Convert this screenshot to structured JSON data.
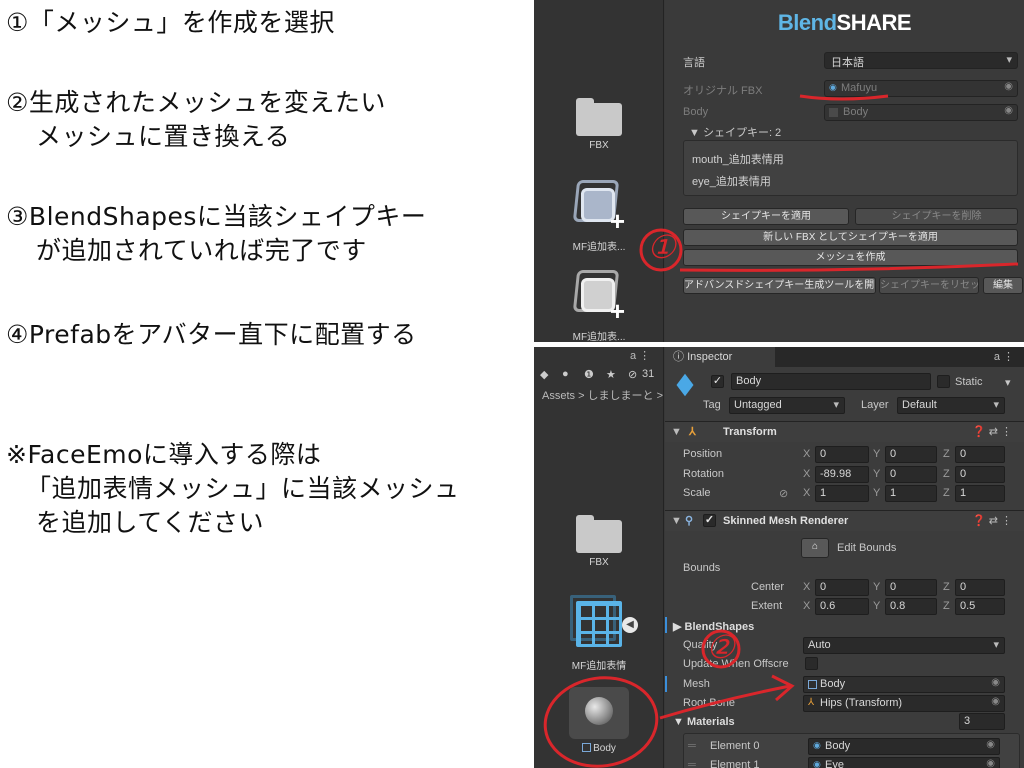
{
  "instructions": {
    "step1": "①「メッシュ」を作成を選択",
    "step2_line1": "②生成されたメッシュを変えたい",
    "step2_line2": "メッシュに置き換える",
    "step3_line1": "③BlendShapesに当該シェイプキー",
    "step3_line2": "が追加されていれば完了です",
    "step4": "④Prefabをアバター直下に配置する",
    "note_line1": "※FaceEmoに導入する際は",
    "note_line2": "「追加表情メッシュ」に当該メッシュ",
    "note_line3": "を追加してください"
  },
  "top_panel": {
    "assets": [
      {
        "name": "FBX",
        "icon": "folder-icon"
      },
      {
        "name": "MF追加表...",
        "icon": "mesh-filter-prefab-icon"
      },
      {
        "name": "MF追加表...",
        "icon": "mesh-filter-prefab-icon"
      }
    ],
    "blendshare": {
      "logo_part1": "Blend",
      "logo_part2": "SHARE",
      "language_label": "言語",
      "language_value": "日本語",
      "original_fbx_label": "オリジナル FBX",
      "original_fbx_value": "Mafuyu",
      "body_label": "Body",
      "body_value": "Body",
      "shapekeys_header": "▼ シェイプキー: 2",
      "shapekeys": [
        "mouth_追加表情用",
        "eye_追加表情用"
      ],
      "btn_apply": "シェイプキーを適用",
      "btn_delete": "シェイプキーを削除",
      "btn_new_fbx": "新しい FBX としてシェイプキーを適用",
      "btn_create_mesh": "メッシュを作成",
      "btn_advanced": "アドバンスドシェイプキー生成ツールを開く",
      "btn_reset": "シェイプキーをリセット",
      "btn_edit": "編集"
    }
  },
  "bottom_panel": {
    "toolbar_count": "31",
    "breadcrumb": "Assets > しましまーと >",
    "assets": [
      {
        "name": "FBX",
        "icon": "folder-icon"
      },
      {
        "name": "MF追加表情",
        "icon": "mesh-grid-icon"
      },
      {
        "name": "Body",
        "icon": "mesh-sphere-icon"
      }
    ],
    "inspector": {
      "tab": "Inspector",
      "object_name": "Body",
      "static_label": "Static",
      "tag_label": "Tag",
      "tag_value": "Untagged",
      "layer_label": "Layer",
      "layer_value": "Default",
      "transform": {
        "title": "Transform",
        "position_label": "Position",
        "rotation_label": "Rotation",
        "scale_label": "Scale",
        "position": [
          "0",
          "0",
          "0"
        ],
        "rotation": [
          "-89.98",
          "0",
          "0"
        ],
        "scale": [
          "1",
          "1",
          "1"
        ]
      },
      "smr": {
        "title": "Skinned Mesh Renderer",
        "edit_bounds": "Edit Bounds",
        "bounds_label": "Bounds",
        "center_label": "Center",
        "extent_label": "Extent",
        "center": [
          "0",
          "0",
          "0"
        ],
        "extent": [
          "0.6",
          "0.8",
          "0.5"
        ],
        "blendshapes_label": "BlendShapes",
        "quality_label": "Quality",
        "quality_value": "Auto",
        "update_label": "Update When Offscre",
        "mesh_label": "Mesh",
        "mesh_value": "Body",
        "rootbone_label": "Root Bone",
        "rootbone_value": "Hips (Transform)"
      },
      "materials": {
        "title": "Materials",
        "count": "3",
        "items": [
          {
            "label": "Element 0",
            "value": "Body"
          },
          {
            "label": "Element 1",
            "value": "Eye"
          }
        ]
      }
    }
  },
  "annotations": {
    "mark1": "①",
    "mark2": "②"
  }
}
